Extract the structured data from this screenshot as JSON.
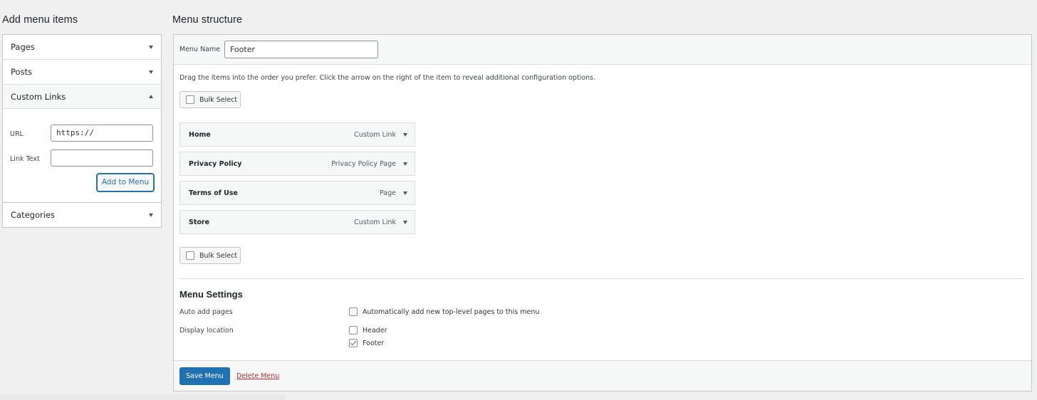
{
  "add_menu_items": {
    "heading": "Add menu items",
    "sections": [
      {
        "label": "Pages",
        "state": "collapsed"
      },
      {
        "label": "Posts",
        "state": "collapsed"
      },
      {
        "label": "Custom Links",
        "state": "expanded"
      },
      {
        "label": "Categories",
        "state": "collapsed"
      }
    ],
    "custom_links": {
      "url_label": "URL",
      "url_value": "https://",
      "link_text_label": "Link Text",
      "link_text_value": "",
      "add_button": "Add to Menu"
    }
  },
  "menu_structure": {
    "heading": "Menu structure",
    "menu_name_label": "Menu Name",
    "menu_name_value": "Footer",
    "instructions": "Drag the items into the order you prefer. Click the arrow on the right of the item to reveal additional configuration options.",
    "bulk_select_label": "Bulk Select",
    "items": [
      {
        "title": "Home",
        "type": "Custom Link"
      },
      {
        "title": "Privacy Policy",
        "type": "Privacy Policy Page"
      },
      {
        "title": "Terms of Use",
        "type": "Page"
      },
      {
        "title": "Store",
        "type": "Custom Link"
      }
    ]
  },
  "menu_settings": {
    "title": "Menu Settings",
    "auto_add_label": "Auto add pages",
    "auto_add_option": "Automatically add new top-level pages to this menu",
    "auto_add_checked": false,
    "display_location_label": "Display location",
    "locations": [
      {
        "label": "Header",
        "checked": false
      },
      {
        "label": "Footer",
        "checked": true
      }
    ]
  },
  "footer_actions": {
    "save_label": "Save Menu",
    "delete_label": "Delete Menu"
  },
  "colors": {
    "accent": "#2271b1",
    "danger": "#b32d2e",
    "background": "#f0f0f1"
  }
}
